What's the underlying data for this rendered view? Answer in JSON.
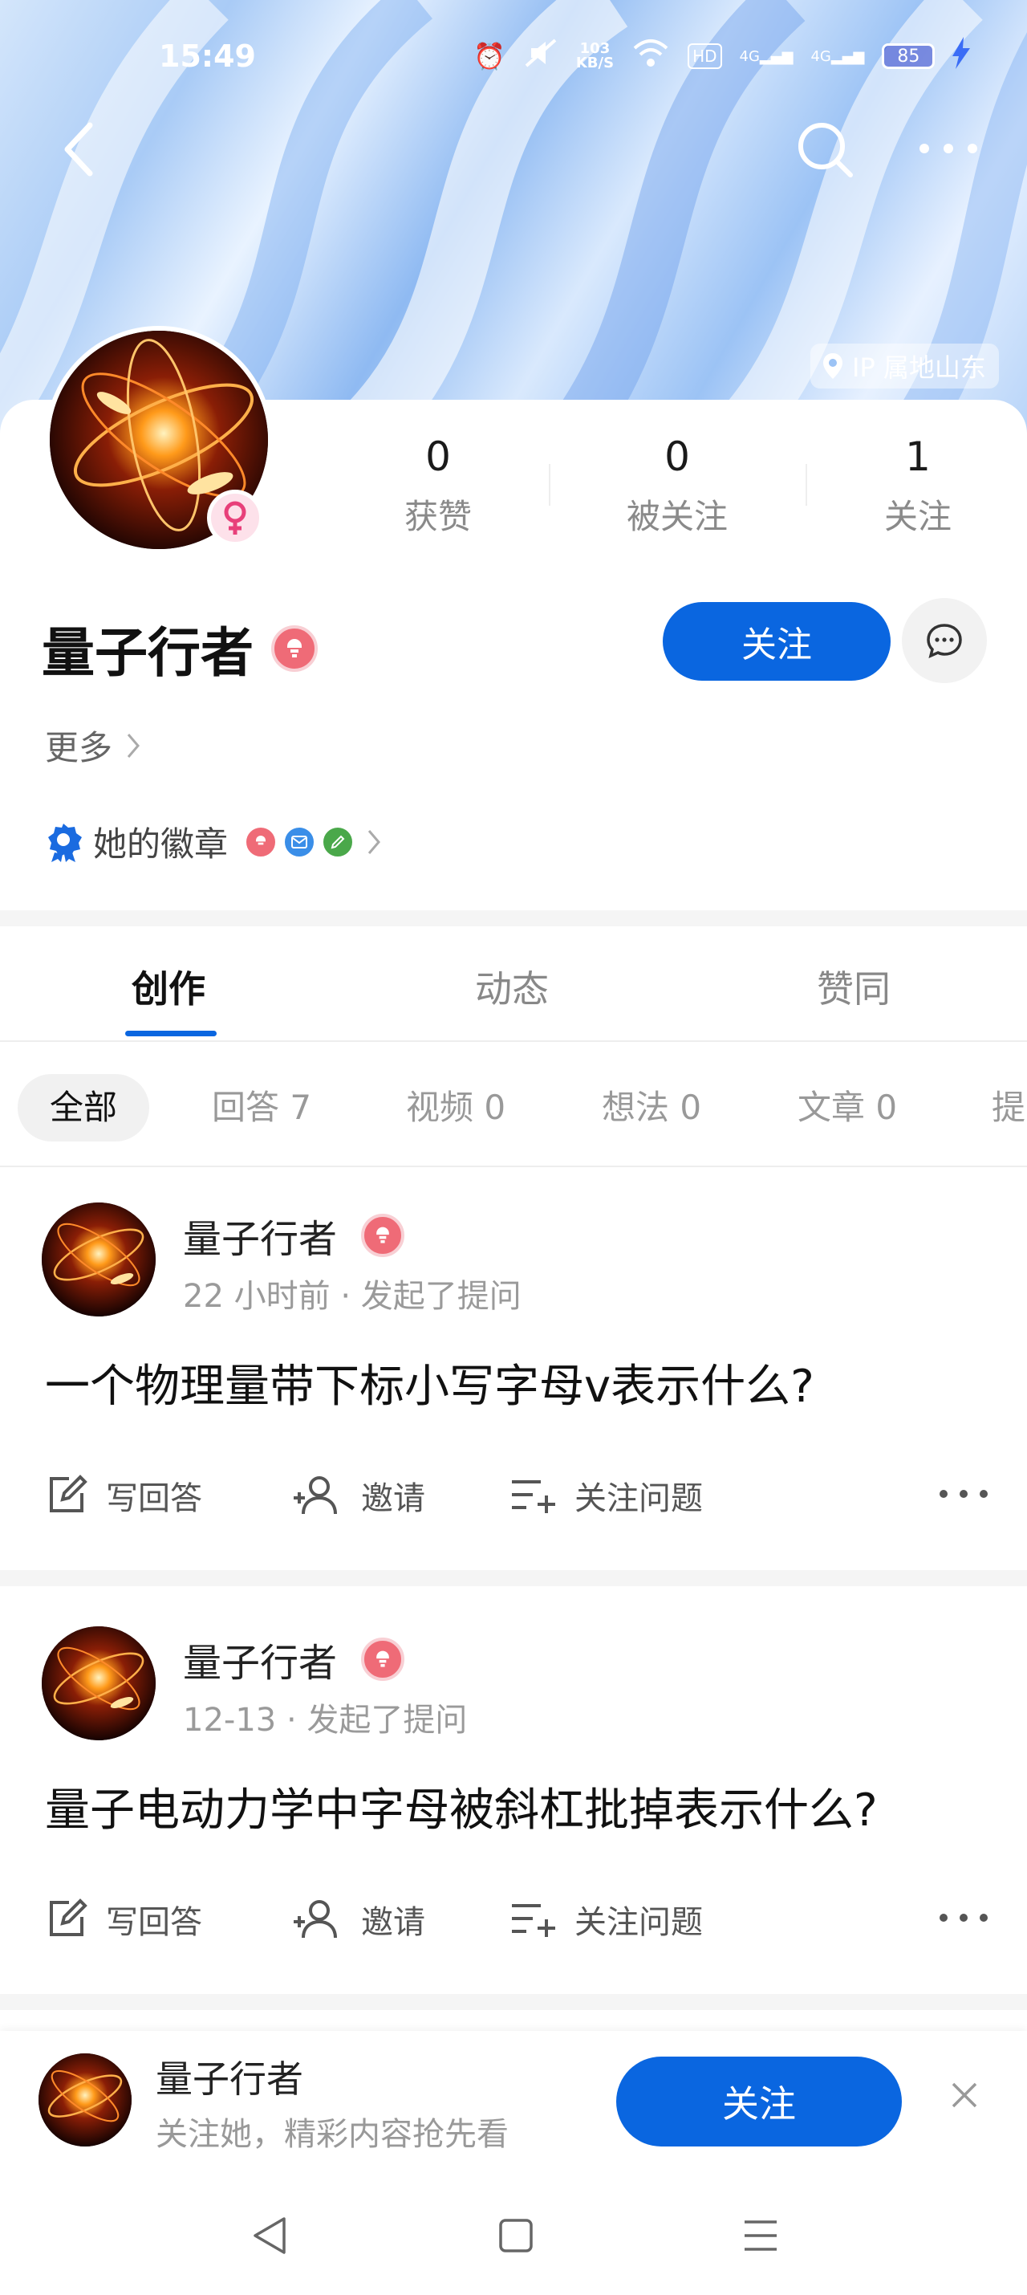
{
  "status_bar": {
    "time": "15:49",
    "net_speed_value": "103",
    "net_speed_unit": "KB/S",
    "hd_label": "HD",
    "sim1": "4G",
    "sim2": "4G",
    "battery": "85"
  },
  "header": {
    "ip_location": "IP 属地山东"
  },
  "profile": {
    "name": "量子行者",
    "stats": [
      {
        "value": "0",
        "label": "获赞"
      },
      {
        "value": "0",
        "label": "被关注"
      },
      {
        "value": "1",
        "label": "关注"
      }
    ],
    "follow_label": "关注",
    "more_label": "更多",
    "badges_label": "她的徽章"
  },
  "tabs": [
    {
      "label": "创作",
      "active": true
    },
    {
      "label": "动态",
      "active": false
    },
    {
      "label": "赞同",
      "active": false
    }
  ],
  "filters": [
    {
      "label": "全部",
      "active": true
    },
    {
      "label": "回答 7"
    },
    {
      "label": "视频 0"
    },
    {
      "label": "想法 0"
    },
    {
      "label": "文章 0"
    },
    {
      "label": "提"
    }
  ],
  "posts": [
    {
      "author": "量子行者",
      "meta": "22 小时前 · 发起了提问",
      "title": "一个物理量带下标小写字母v表示什么?",
      "actions": {
        "answer": "写回答",
        "invite": "邀请",
        "follow_q": "关注问题"
      }
    },
    {
      "author": "量子行者",
      "meta": "12-13 · 发起了提问",
      "title": "量子电动力学中字母被斜杠批掉表示什么?",
      "actions": {
        "answer": "写回答",
        "invite": "邀请",
        "follow_q": "关注问题"
      }
    }
  ],
  "follow_bar": {
    "name": "量子行者",
    "subtitle": "关注她，精彩内容抢先看",
    "button": "关注"
  },
  "colors": {
    "accent": "#0a66e0",
    "badge_pink": "#ef6b77",
    "gender_pink": "#e8407a"
  }
}
